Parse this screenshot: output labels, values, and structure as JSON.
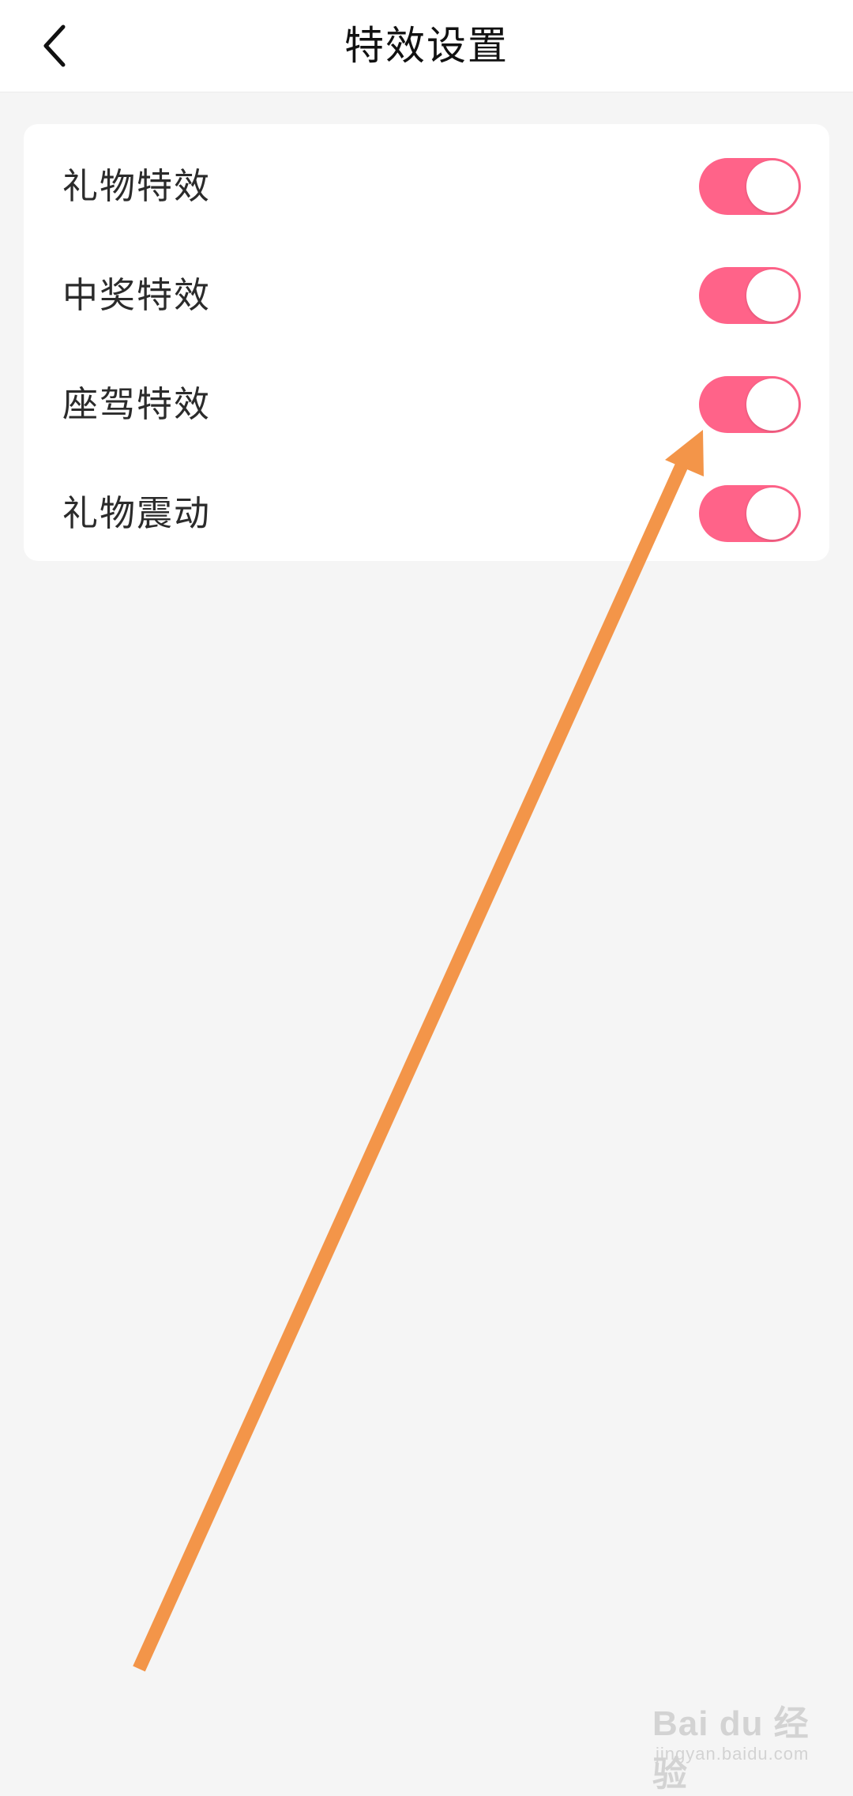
{
  "header": {
    "title": "特效设置",
    "back_icon": "chevron-left-icon"
  },
  "settings": {
    "items": [
      {
        "label": "礼物特效",
        "enabled": true
      },
      {
        "label": "中奖特效",
        "enabled": true
      },
      {
        "label": "座驾特效",
        "enabled": true
      },
      {
        "label": "礼物震动",
        "enabled": true
      }
    ]
  },
  "colors": {
    "toggle_on": "#ff6389",
    "annotation_arrow": "#f39549",
    "background": "#f5f5f5"
  },
  "watermark": {
    "logo": "Bai du 经验",
    "sub": "jingyan.baidu.com"
  }
}
